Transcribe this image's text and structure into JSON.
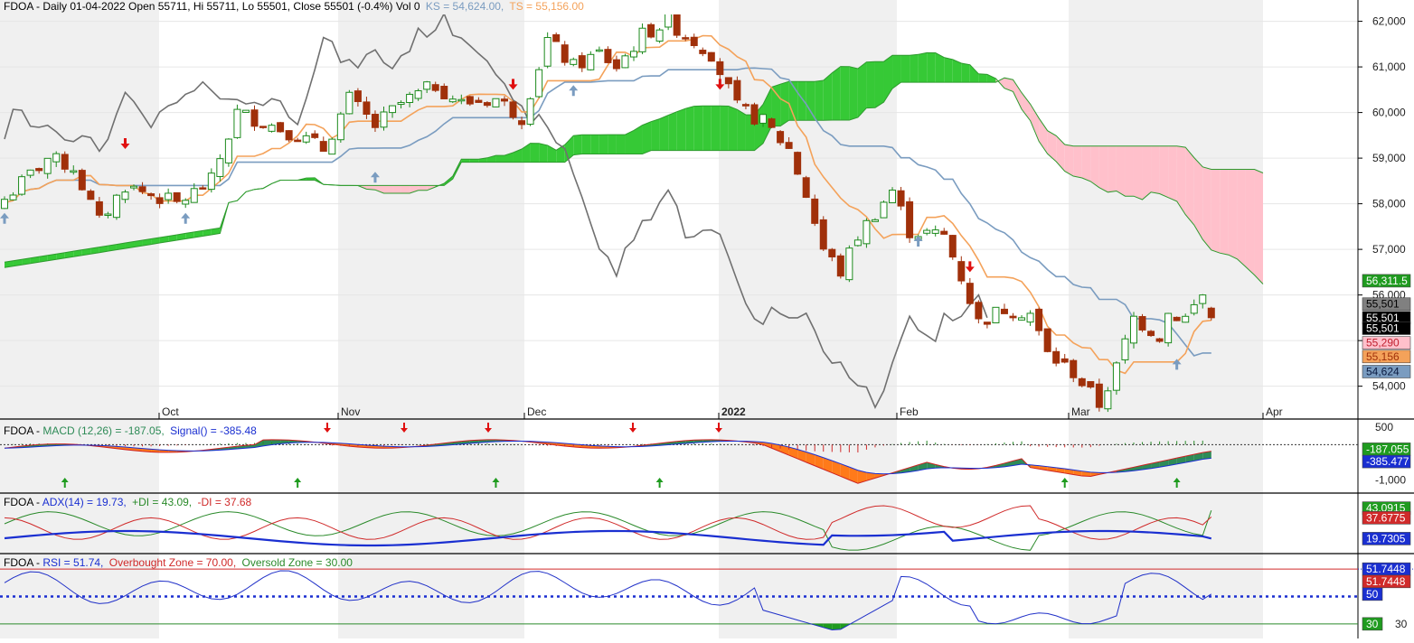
{
  "colors": {
    "background": "#ffffff",
    "shade": "#f0f0f0",
    "gridline": "#e6e6e6",
    "bull_fill": "#ffffff",
    "bull_stroke": "#1c8a1c",
    "bear": "#a0300a",
    "kijun": "#7a9cc0",
    "tenkan": "#f4a25a",
    "chikou": "#707070",
    "cloud_bull": "#36c936",
    "cloud_bear": "#ffc0cb",
    "span_line": "#2e9b2e",
    "macd_pos": "#2e8b57",
    "macd_neg": "#ff7a1a",
    "signal_line": "#cc2222",
    "adx_line": "#1a2fd1",
    "plus_di": "#2a8a2a",
    "minus_di": "#d02a2a",
    "rsi_line": "#2030c8",
    "ob_line": "#d02a2a",
    "os_line": "#2a8a2a",
    "arrow_up_green": "#1f9b1f",
    "arrow_up_blue": "#7a9cc0",
    "arrow_down_red": "#e01010"
  },
  "header": {
    "price": "FDOA - Daily 01-04-2022 Open 55711, Hi 55711, Lo 55501, Close 55501 (-0.4%) Vol 0",
    "ks": "KS = 54,624.00,",
    "ts": "TS = 55,156.00",
    "macd_prefix": "FDOA - ",
    "macd_main": "MACD (12,26) = -187.05,",
    "macd_sig": "Signal() = -385.48",
    "adx_prefix": "FDOA - ",
    "adx_main": "ADX(14) = 19.73,",
    "adx_plus": "+DI = 43.09,",
    "adx_minus": "-DI = 37.68",
    "rsi_prefix": "FDOA - ",
    "rsi_main": "RSI = 51.74,",
    "rsi_ob": "Overbought Zone = 70.00,",
    "rsi_os": "Oversold Zone = 30.00"
  },
  "chart_data": {
    "type": "candlestick",
    "x_labels": [
      "Oct",
      "Nov",
      "Dec",
      "2022",
      "Feb",
      "Mar",
      "Apr"
    ],
    "price_axis_ticks": [
      "54,000",
      "55,000",
      "56,000",
      "57,000",
      "58,000",
      "59,000",
      "60,000",
      "61,000",
      "62,000"
    ],
    "price_axis_values": [
      54000,
      55000,
      56000,
      57000,
      58000,
      59000,
      60000,
      61000,
      62000
    ],
    "price_range": [
      53300,
      62150
    ],
    "price_tags": [
      {
        "text": "56,311.5",
        "value": 56311.5,
        "bg": "#1f9b1f",
        "fg": "#ffffff"
      },
      {
        "text": "55,501",
        "value": 55800,
        "bg": "#808080",
        "fg": "#000000"
      },
      {
        "text": "55,501",
        "value": 55501,
        "bg": "#000000",
        "fg": "#ffffff"
      },
      {
        "text": "55,501",
        "value": 55270,
        "bg": "#000000",
        "fg": "#ffffff"
      },
      {
        "text": "55,290",
        "value": 54950,
        "bg": "#ffc0cb",
        "fg": "#c02030"
      },
      {
        "text": "55,156",
        "value": 54650,
        "bg": "#f4a25a",
        "fg": "#a0300a"
      },
      {
        "text": "54,624",
        "value": 54320,
        "bg": "#7a9cc0",
        "fg": "#0a1a40"
      }
    ],
    "macd": {
      "value": -187.05,
      "signal": -385.48,
      "range": [
        -1350,
        650
      ],
      "ticks": [
        {
          "text": "500",
          "value": 500
        },
        {
          "text": "-1,000",
          "value": -1000
        }
      ],
      "tags": [
        {
          "text": "-187.055",
          "value": -130,
          "bg": "#1f9b1f",
          "fg": "#ffffff"
        },
        {
          "text": "-385.477",
          "value": -480,
          "bg": "#1a2fd1",
          "fg": "#ffffff"
        }
      ]
    },
    "adx": {
      "adx": 19.73,
      "plus_di": 43.09,
      "minus_di": 37.68,
      "range": [
        8,
        56
      ],
      "tags": [
        {
          "text": "43.0915",
          "value": 45,
          "bg": "#1f9b1f",
          "fg": "#ffffff"
        },
        {
          "text": "37.6775",
          "value": 37,
          "bg": "#d02a2a",
          "fg": "#ffffff"
        },
        {
          "text": "19.7305",
          "value": 19.7,
          "bg": "#1a2fd1",
          "fg": "#ffffff"
        }
      ]
    },
    "rsi": {
      "value": 51.74,
      "overbought": 70.0,
      "oversold": 30.0,
      "range": [
        20,
        80
      ],
      "tags": [
        {
          "text": "51.7448",
          "value": 70,
          "bg": "#1a2fd1",
          "fg": "#ffffff"
        },
        {
          "text": "51.7448",
          "value": 61,
          "bg": "#d02a2a",
          "fg": "#ffffff"
        },
        {
          "text": "50",
          "value": 51.74,
          "bg": "#1a2fd1",
          "fg": "#ffffff"
        },
        {
          "text": "30",
          "value": 30,
          "bg": "#1f9b1f",
          "fg": "#ffffff"
        }
      ],
      "axis_label": "30"
    }
  }
}
